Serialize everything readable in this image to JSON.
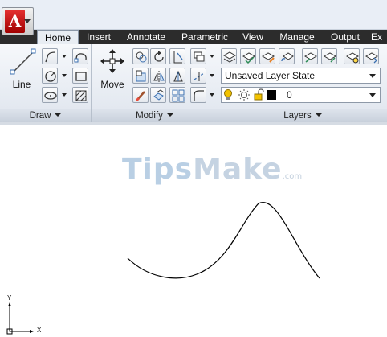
{
  "tabs": [
    {
      "label": "Home",
      "active": true
    },
    {
      "label": "Insert"
    },
    {
      "label": "Annotate"
    },
    {
      "label": "Parametric"
    },
    {
      "label": "View"
    },
    {
      "label": "Manage"
    },
    {
      "label": "Output"
    },
    {
      "label": "Ex"
    }
  ],
  "panels": {
    "draw": {
      "title": "Draw",
      "line_label": "Line"
    },
    "modify": {
      "title": "Modify",
      "move_label": "Move"
    },
    "layers": {
      "title": "Layers",
      "layer_state": "Unsaved Layer State",
      "current_layer": "0",
      "layer_color": "#000000"
    }
  },
  "watermark": {
    "brand": "TipsMake",
    "brand_part1": "Tips",
    "brand_part2": "Make",
    "suffix": ".com"
  },
  "ucs": {
    "x_label": "X",
    "y_label": "Y"
  },
  "colors": {
    "app_red": "#cc1111",
    "tab_bar": "#2c2c2c",
    "bulb": "#f2c200"
  }
}
